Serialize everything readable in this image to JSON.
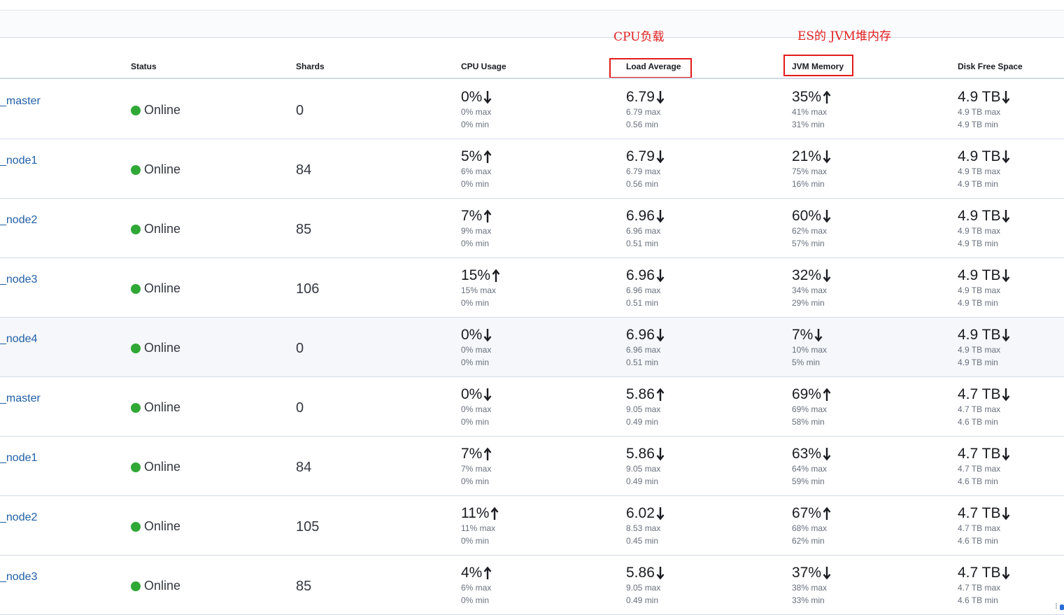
{
  "annotations": {
    "cpu_load": "CPU负载",
    "jvm_heap": "ES的 JVM堆内存"
  },
  "columns": {
    "status": "Status",
    "shards": "Shards",
    "cpu_usage": "CPU Usage",
    "load_average": "Load Average",
    "jvm_memory": "JVM Memory",
    "disk_free_space": "Disk Free Space"
  },
  "status_color": "#2fa836",
  "link_color": "#1f5fa6",
  "rows": [
    {
      "name": "_master",
      "status": "Online",
      "shards": "0",
      "cpu": {
        "value": "0%",
        "trend": "down",
        "max": "0% max",
        "min": "0% min"
      },
      "load": {
        "value": "6.79",
        "trend": "down",
        "max": "6.79 max",
        "min": "0.56 min"
      },
      "jvm": {
        "value": "35%",
        "trend": "up",
        "max": "41% max",
        "min": "31% min"
      },
      "disk": {
        "value": "4.9 TB",
        "trend": "down",
        "max": "4.9 TB max",
        "min": "4.9 TB min"
      }
    },
    {
      "name": "_node1",
      "status": "Online",
      "shards": "84",
      "cpu": {
        "value": "5%",
        "trend": "up",
        "max": "6% max",
        "min": "0% min"
      },
      "load": {
        "value": "6.79",
        "trend": "down",
        "max": "6.79 max",
        "min": "0.56 min"
      },
      "jvm": {
        "value": "21%",
        "trend": "down",
        "max": "75% max",
        "min": "16% min"
      },
      "disk": {
        "value": "4.9 TB",
        "trend": "down",
        "max": "4.9 TB max",
        "min": "4.9 TB min"
      }
    },
    {
      "name": "_node2",
      "status": "Online",
      "shards": "85",
      "cpu": {
        "value": "7%",
        "trend": "up",
        "max": "9% max",
        "min": "0% min"
      },
      "load": {
        "value": "6.96",
        "trend": "down",
        "max": "6.96 max",
        "min": "0.51 min"
      },
      "jvm": {
        "value": "60%",
        "trend": "down",
        "max": "62% max",
        "min": "57% min"
      },
      "disk": {
        "value": "4.9 TB",
        "trend": "down",
        "max": "4.9 TB max",
        "min": "4.9 TB min"
      }
    },
    {
      "name": "_node3",
      "status": "Online",
      "shards": "106",
      "cpu": {
        "value": "15%",
        "trend": "up",
        "max": "15% max",
        "min": "0% min"
      },
      "load": {
        "value": "6.96",
        "trend": "down",
        "max": "6.96 max",
        "min": "0.51 min"
      },
      "jvm": {
        "value": "32%",
        "trend": "down",
        "max": "34% max",
        "min": "29% min"
      },
      "disk": {
        "value": "4.9 TB",
        "trend": "down",
        "max": "4.9 TB max",
        "min": "4.9 TB min"
      }
    },
    {
      "name": "_node4",
      "status": "Online",
      "shards": "0",
      "cpu": {
        "value": "0%",
        "trend": "down",
        "max": "0% max",
        "min": "0% min"
      },
      "load": {
        "value": "6.96",
        "trend": "down",
        "max": "6.96 max",
        "min": "0.51 min"
      },
      "jvm": {
        "value": "7%",
        "trend": "down",
        "max": "10% max",
        "min": "5% min"
      },
      "disk": {
        "value": "4.9 TB",
        "trend": "down",
        "max": "4.9 TB max",
        "min": "4.9 TB min"
      }
    },
    {
      "name": "_master",
      "status": "Online",
      "shards": "0",
      "cpu": {
        "value": "0%",
        "trend": "down",
        "max": "0% max",
        "min": "0% min"
      },
      "load": {
        "value": "5.86",
        "trend": "up",
        "max": "9.05 max",
        "min": "0.49 min"
      },
      "jvm": {
        "value": "69%",
        "trend": "up",
        "max": "69% max",
        "min": "58% min"
      },
      "disk": {
        "value": "4.7 TB",
        "trend": "down",
        "max": "4.7 TB max",
        "min": "4.6 TB min"
      }
    },
    {
      "name": "_node1",
      "status": "Online",
      "shards": "84",
      "cpu": {
        "value": "7%",
        "trend": "up",
        "max": "7% max",
        "min": "0% min"
      },
      "load": {
        "value": "5.86",
        "trend": "down",
        "max": "9.05 max",
        "min": "0.49 min"
      },
      "jvm": {
        "value": "63%",
        "trend": "down",
        "max": "64% max",
        "min": "59% min"
      },
      "disk": {
        "value": "4.7 TB",
        "trend": "down",
        "max": "4.7 TB max",
        "min": "4.6 TB min"
      }
    },
    {
      "name": "_node2",
      "status": "Online",
      "shards": "105",
      "cpu": {
        "value": "11%",
        "trend": "up",
        "max": "11% max",
        "min": "0% min"
      },
      "load": {
        "value": "6.02",
        "trend": "down",
        "max": "8.53 max",
        "min": "0.45 min"
      },
      "jvm": {
        "value": "67%",
        "trend": "up",
        "max": "68% max",
        "min": "62% min"
      },
      "disk": {
        "value": "4.7 TB",
        "trend": "down",
        "max": "4.7 TB max",
        "min": "4.6 TB min"
      }
    },
    {
      "name": "_node3",
      "status": "Online",
      "shards": "85",
      "cpu": {
        "value": "4%",
        "trend": "up",
        "max": "6% max",
        "min": "0% min"
      },
      "load": {
        "value": "5.86",
        "trend": "down",
        "max": "9.05 max",
        "min": "0.49 min"
      },
      "jvm": {
        "value": "37%",
        "trend": "down",
        "max": "38% max",
        "min": "33% min"
      },
      "disk": {
        "value": "4.7 TB",
        "trend": "down",
        "max": "4.7 TB max",
        "min": "4.6 TB min"
      }
    }
  ]
}
